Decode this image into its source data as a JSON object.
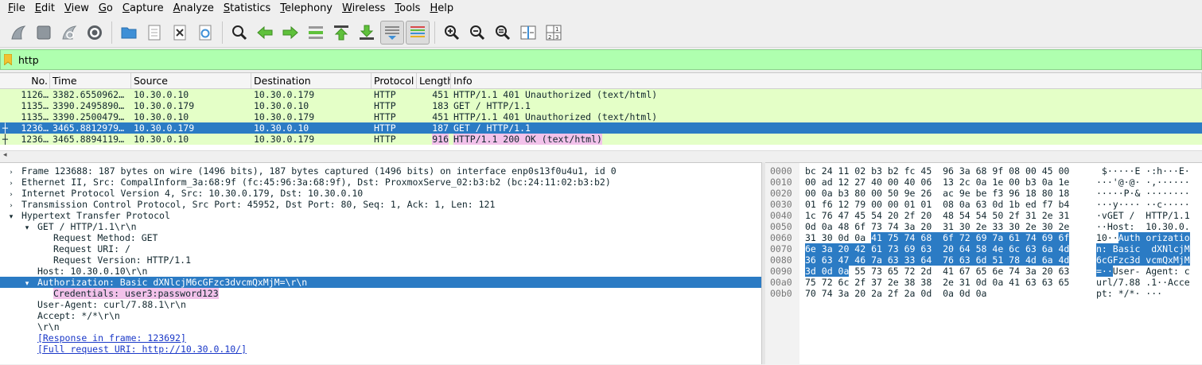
{
  "menu": [
    "File",
    "Edit",
    "View",
    "Go",
    "Capture",
    "Analyze",
    "Statistics",
    "Telephony",
    "Wireless",
    "Tools",
    "Help"
  ],
  "toolbar_icons": [
    "shark-fin-start-icon",
    "stop-square-icon",
    "restart-fin-icon",
    "options-gear-icon",
    "open-folder-icon",
    "file-icon",
    "close-file-icon",
    "reload-icon",
    "find-magnifier-icon",
    "go-back-icon",
    "go-forward-icon",
    "go-to-packet-icon",
    "go-first-icon",
    "go-last-icon",
    "autoscroll-icon",
    "colorize-icon",
    "zoom-in-icon",
    "zoom-out-icon",
    "normal-size-icon",
    "resize-columns-icon",
    "layout-icon"
  ],
  "filter": {
    "value": "http"
  },
  "packet_list": {
    "columns": [
      "No.",
      "Time",
      "Source",
      "Destination",
      "Protocol",
      "Length",
      "Info"
    ],
    "rows": [
      {
        "no": "1126…",
        "time": "3382.6550962…",
        "src": "10.30.0.10",
        "dst": "10.30.0.179",
        "proto": "HTTP",
        "len": "451",
        "info": "HTTP/1.1 401 Unauthorized  (text/html)",
        "selected": false
      },
      {
        "no": "1135…",
        "time": "3390.2495890…",
        "src": "10.30.0.179",
        "dst": "10.30.0.10",
        "proto": "HTTP",
        "len": "183",
        "info": "GET / HTTP/1.1",
        "selected": false
      },
      {
        "no": "1135…",
        "time": "3390.2500479…",
        "src": "10.30.0.10",
        "dst": "10.30.0.179",
        "proto": "HTTP",
        "len": "451",
        "info": "HTTP/1.1 401 Unauthorized  (text/html)",
        "selected": false
      },
      {
        "no": "1236…",
        "time": "3465.8812979…",
        "src": "10.30.0.179",
        "dst": "10.30.0.10",
        "proto": "HTTP",
        "len": "187",
        "info": "GET / HTTP/1.1",
        "selected": true
      },
      {
        "no": "1236…",
        "time": "3465.8894119…",
        "src": "10.30.0.10",
        "dst": "10.30.0.179",
        "proto": "HTTP",
        "len": "916",
        "info": "HTTP/1.1 200 OK  (text/html)",
        "selected": false
      }
    ]
  },
  "details": [
    {
      "indent": 0,
      "arrow": "right",
      "text": "Frame 123688: 187 bytes on wire (1496 bits), 187 bytes captured (1496 bits) on interface enp0s13f0u4u1, id 0"
    },
    {
      "indent": 0,
      "arrow": "right",
      "text": "Ethernet II, Src: CompalInform_3a:68:9f (fc:45:96:3a:68:9f), Dst: ProxmoxServe_02:b3:b2 (bc:24:11:02:b3:b2)"
    },
    {
      "indent": 0,
      "arrow": "right",
      "text": "Internet Protocol Version 4, Src: 10.30.0.179, Dst: 10.30.0.10"
    },
    {
      "indent": 0,
      "arrow": "right",
      "text": "Transmission Control Protocol, Src Port: 45952, Dst Port: 80, Seq: 1, Ack: 1, Len: 121"
    },
    {
      "indent": 0,
      "arrow": "down",
      "text": "Hypertext Transfer Protocol"
    },
    {
      "indent": 1,
      "arrow": "down",
      "text": "GET / HTTP/1.1\\r\\n"
    },
    {
      "indent": 2,
      "arrow": "",
      "text": "Request Method: GET"
    },
    {
      "indent": 2,
      "arrow": "",
      "text": "Request URI: /"
    },
    {
      "indent": 2,
      "arrow": "",
      "text": "Request Version: HTTP/1.1"
    },
    {
      "indent": 1,
      "arrow": "",
      "text": "Host: 10.30.0.10\\r\\n"
    },
    {
      "indent": 1,
      "arrow": "down",
      "text": "Authorization: Basic dXNlcjM6cGFzc3dvcmQxMjM=\\r\\n",
      "selected": true
    },
    {
      "indent": 2,
      "arrow": "",
      "text": "Credentials: user3:password123",
      "cred": true
    },
    {
      "indent": 1,
      "arrow": "",
      "text": "User-Agent: curl/7.88.1\\r\\n"
    },
    {
      "indent": 1,
      "arrow": "",
      "text": "Accept: */*\\r\\n"
    },
    {
      "indent": 1,
      "arrow": "",
      "text": "\\r\\n"
    },
    {
      "indent": 1,
      "arrow": "",
      "text": "[Response in frame: 123692]",
      "link": true
    },
    {
      "indent": 1,
      "arrow": "",
      "text": "[Full request URI: http://10.30.0.10/]",
      "link": true
    }
  ],
  "bytes": [
    {
      "off": "0000",
      "hex": [
        [
          "bc 24 11 02 b3 b2 fc 45  96 3a 68 9f 08 00 45 00",
          false
        ]
      ],
      "asc": [
        [
          " $·····E ·:h···E·",
          false
        ]
      ]
    },
    {
      "off": "0010",
      "hex": [
        [
          "00 ad 12 27 40 00 40 06  13 2c 0a 1e 00 b3 0a 1e",
          false
        ]
      ],
      "asc": [
        [
          "···'@·@· ·,······",
          false
        ]
      ]
    },
    {
      "off": "0020",
      "hex": [
        [
          "00 0a b3 80 00 50 9e 26  ac 9e be f3 96 18 80 18",
          false
        ]
      ],
      "asc": [
        [
          "·····P·& ········",
          false
        ]
      ]
    },
    {
      "off": "0030",
      "hex": [
        [
          "01 f6 12 79 00 00 01 01  08 0a 63 0d 1b ed f7 b4",
          false
        ]
      ],
      "asc": [
        [
          "···y···· ··c·····",
          false
        ]
      ]
    },
    {
      "off": "0040",
      "hex": [
        [
          "1c 76 47 45 54 20 2f 20  48 54 54 50 2f 31 2e 31",
          false
        ]
      ],
      "asc": [
        [
          "·vGET /  HTTP/1.1",
          false
        ]
      ]
    },
    {
      "off": "0050",
      "hex": [
        [
          "0d 0a 48 6f 73 74 3a 20  31 30 2e 33 30 2e 30 2e",
          false
        ]
      ],
      "asc": [
        [
          "··Host:  10.30.0.",
          false
        ]
      ]
    },
    {
      "off": "0060",
      "hex": [
        [
          "31 30 0d 0a ",
          false
        ],
        [
          "41 75 74 68  6f 72 69 7a 61 74 69 6f",
          true
        ]
      ],
      "asc": [
        [
          "10··",
          false
        ],
        [
          "Auth orizatio",
          true
        ]
      ]
    },
    {
      "off": "0070",
      "hex": [
        [
          "6e 3a 20 42 61 73 69 63  20 64 58 4e 6c 63 6a 4d",
          true
        ]
      ],
      "asc": [
        [
          "n: Basic  dXNlcjM",
          true
        ]
      ]
    },
    {
      "off": "0080",
      "hex": [
        [
          "36 63 47 46 7a 63 33 64  76 63 6d 51 78 4d 6a 4d",
          true
        ]
      ],
      "asc": [
        [
          "6cGFzc3d vcmQxMjM",
          true
        ]
      ]
    },
    {
      "off": "0090",
      "hex": [
        [
          "3d 0d 0a",
          true
        ],
        [
          " 55 73 65 72 2d  41 67 65 6e 74 3a 20 63",
          false
        ]
      ],
      "asc": [
        [
          "=··",
          true
        ],
        [
          "User- Agent: c",
          false
        ]
      ]
    },
    {
      "off": "00a0",
      "hex": [
        [
          "75 72 6c 2f 37 2e 38 38  2e 31 0d 0a 41 63 63 65",
          false
        ]
      ],
      "asc": [
        [
          "url/7.88 .1··Acce",
          false
        ]
      ]
    },
    {
      "off": "00b0",
      "hex": [
        [
          "70 74 3a 20 2a 2f 2a 0d  0a 0d 0a",
          false
        ]
      ],
      "asc": [
        [
          "pt: */*· ···",
          false
        ]
      ]
    }
  ]
}
